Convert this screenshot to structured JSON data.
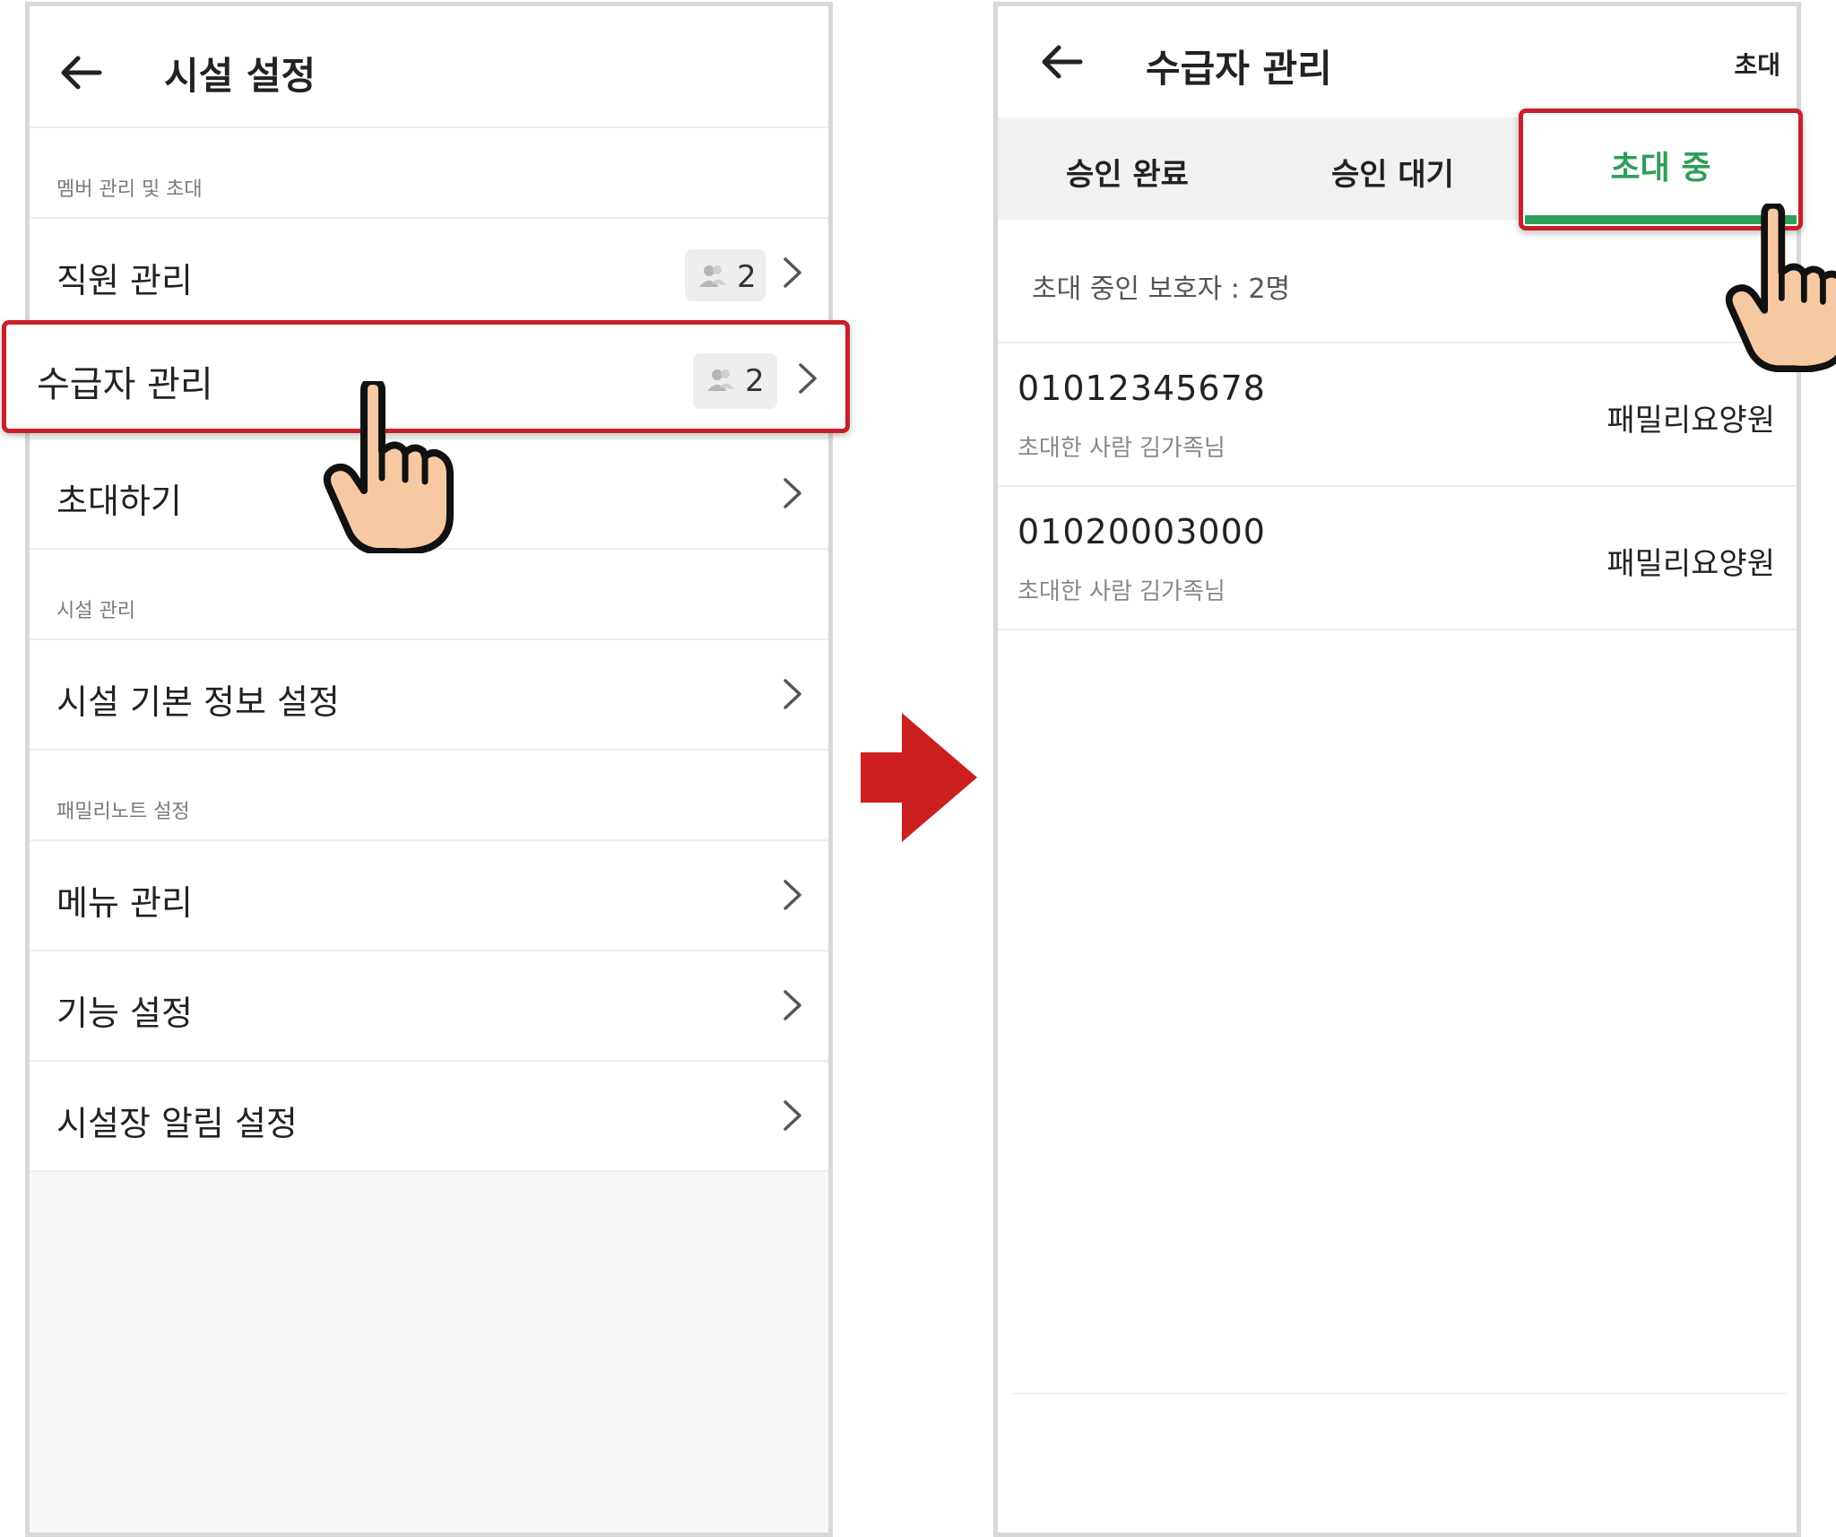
{
  "left_screen": {
    "title": "시설 설정",
    "sections": {
      "members": "멤버 관리 및 초대",
      "facility": "시설 관리",
      "familynote": "패밀리노트 설정"
    },
    "rows": {
      "staff": {
        "label": "직원 관리",
        "count": "2"
      },
      "recipients": {
        "label": "수급자 관리",
        "count": "2"
      },
      "invite": {
        "label": "초대하기"
      },
      "facility_info": {
        "label": "시설 기본 정보 설정"
      },
      "menu": {
        "label": "메뉴 관리"
      },
      "features": {
        "label": "기능 설정"
      },
      "director_alerts": {
        "label": "시설장 알림 설정"
      }
    }
  },
  "right_screen": {
    "title": "수급자 관리",
    "header_action": "초대",
    "tabs": [
      "승인 완료",
      "승인 대기",
      "초대 중"
    ],
    "invite_count_text": "초대 중인 보호자 : 2명",
    "invites": [
      {
        "phone": "01012345678",
        "inviter": "초대한 사람 김가족님",
        "facility": "패밀리요양원"
      },
      {
        "phone": "01020003000",
        "inviter": "초대한 사람 김가족님",
        "facility": "패밀리요양원"
      }
    ]
  },
  "colors": {
    "highlight_border": "#c8202a",
    "active_tab": "#2e9e57",
    "arrow": "#cc1f1f",
    "hand_fill": "#f7c9a3"
  }
}
